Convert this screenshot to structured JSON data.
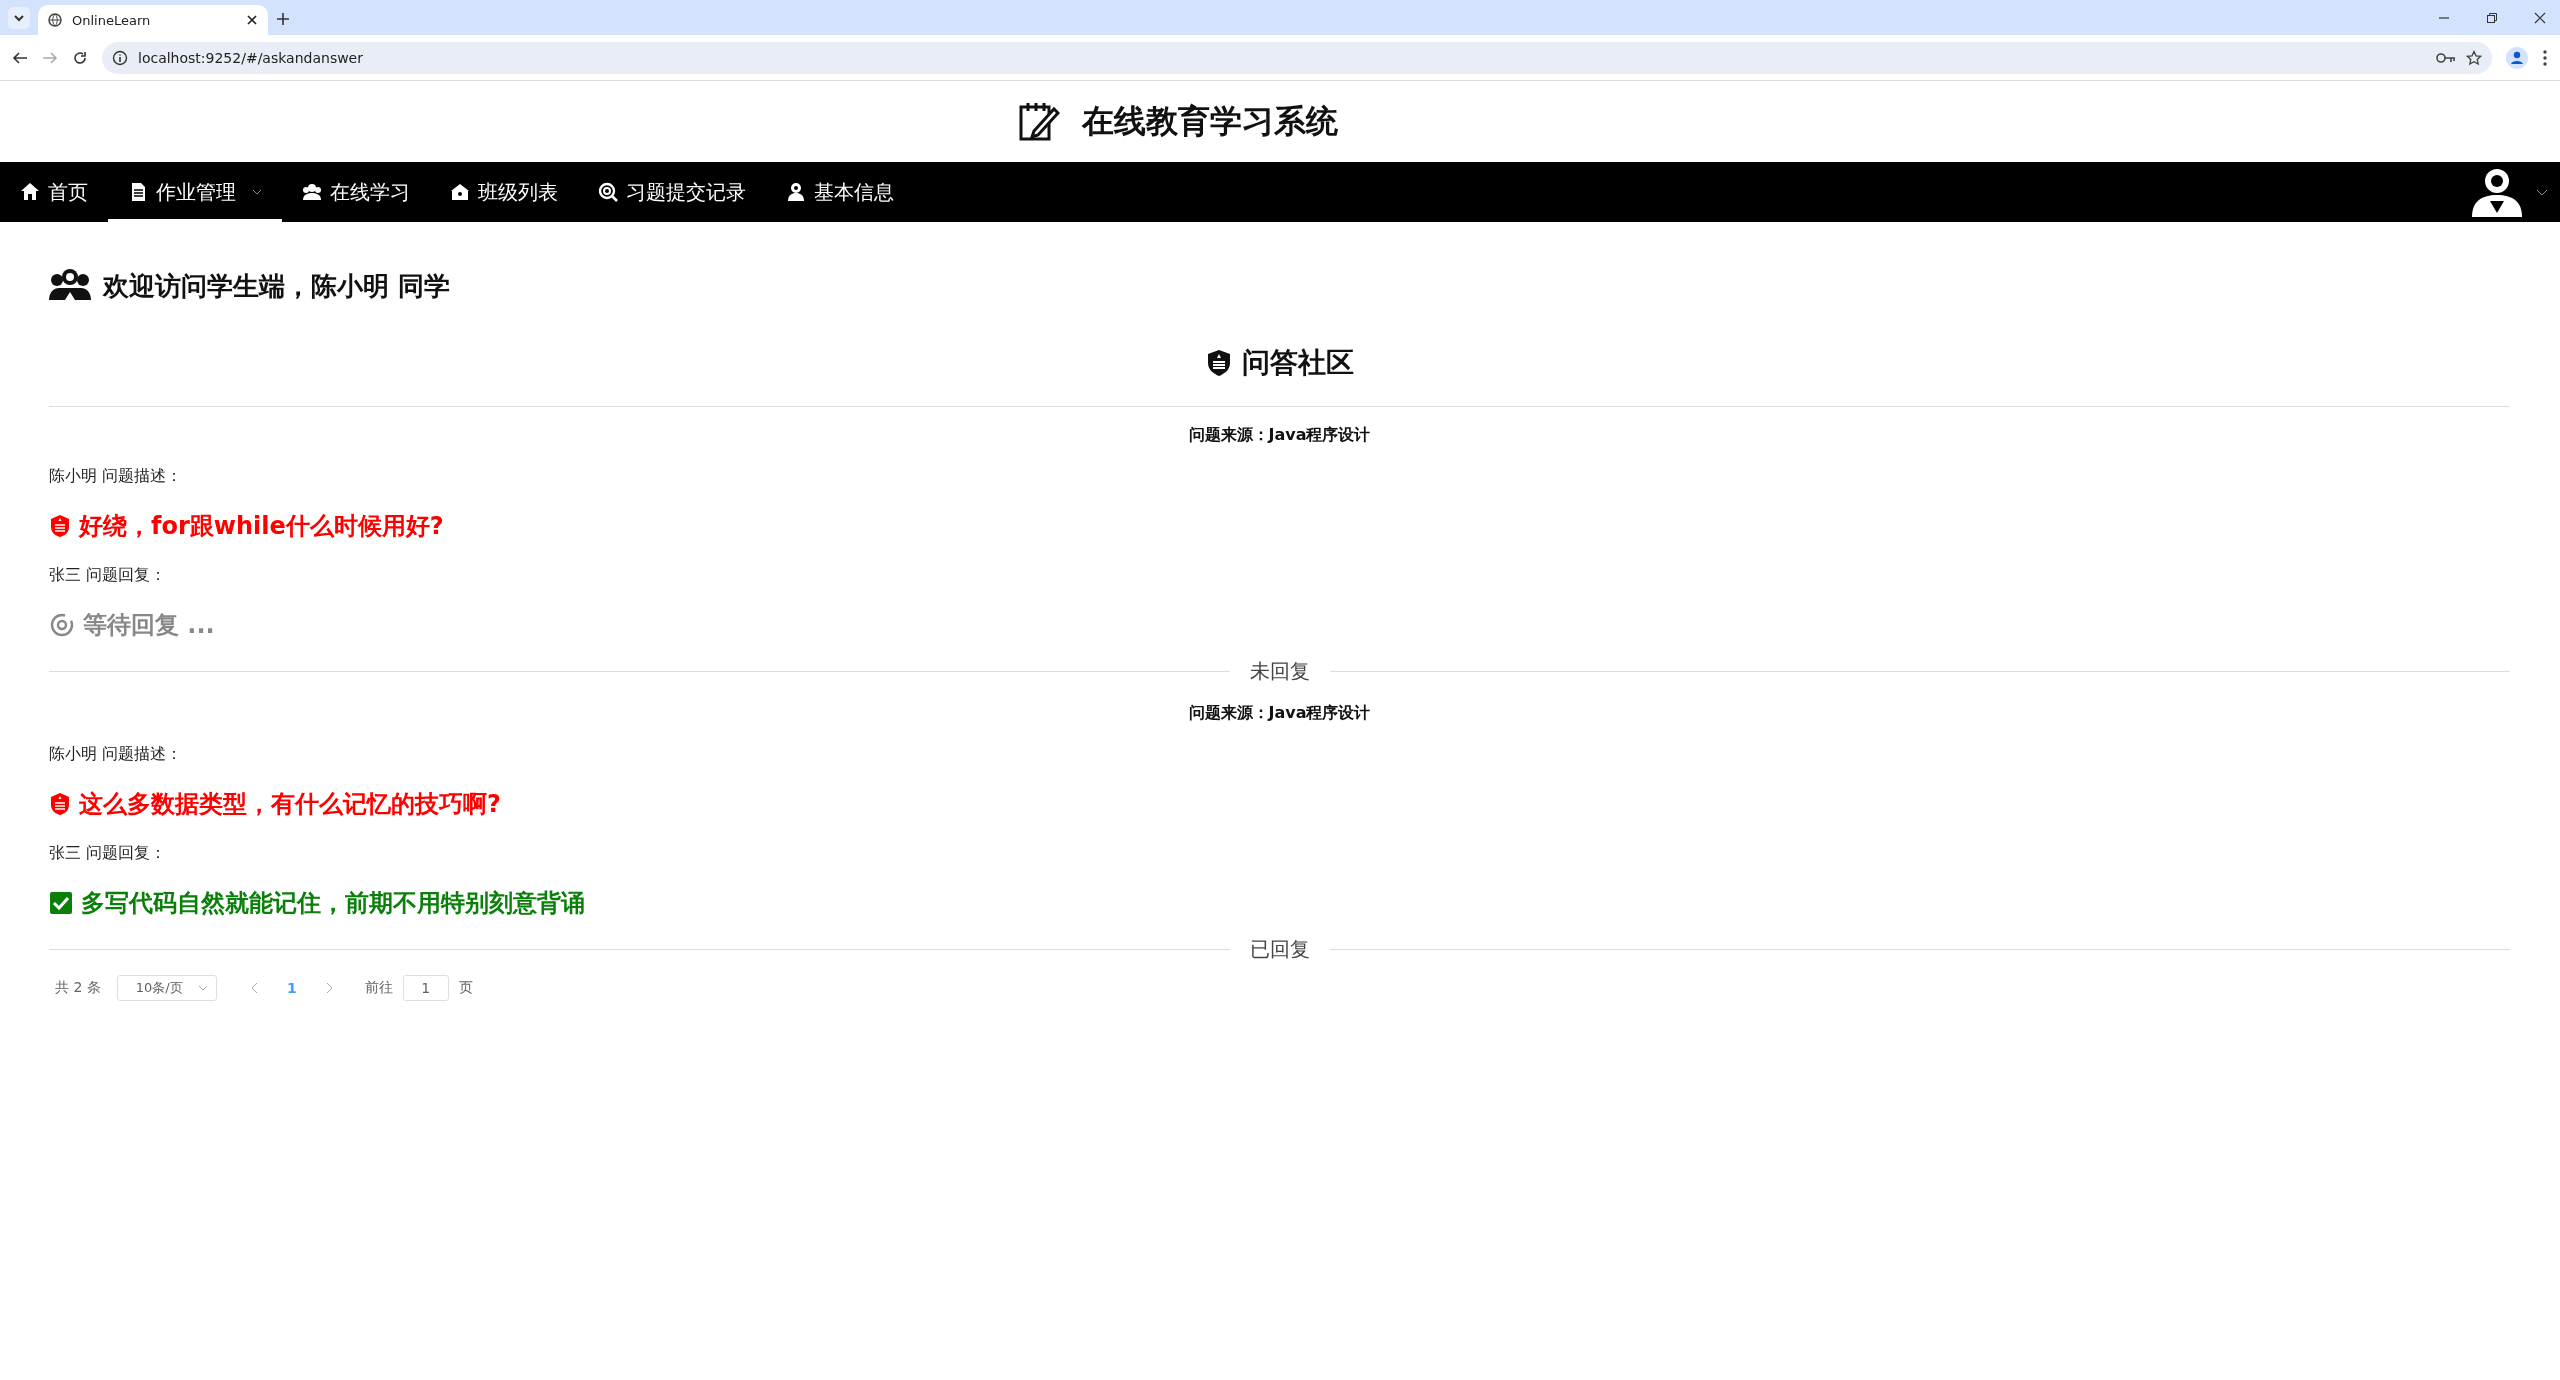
{
  "browser": {
    "tab_title": "OnlineLearn",
    "url": "localhost:9252/#/askandanswer"
  },
  "header": {
    "title": "在线教育学习系统"
  },
  "nav": {
    "items": [
      {
        "label": "首页",
        "selected": false,
        "dropdown": false
      },
      {
        "label": "作业管理",
        "selected": true,
        "dropdown": true
      },
      {
        "label": "在线学习",
        "selected": false,
        "dropdown": false
      },
      {
        "label": "班级列表",
        "selected": false,
        "dropdown": false
      },
      {
        "label": "习题提交记录",
        "selected": false,
        "dropdown": false
      },
      {
        "label": "基本信息",
        "selected": false,
        "dropdown": false
      }
    ]
  },
  "welcome": "欢迎访问学生端，陈小明 同学",
  "community": {
    "title": "问答社区"
  },
  "questions": [
    {
      "source": "问题来源：Java程序设计",
      "asker": "陈小明 问题描述：",
      "question": "好绕，for跟while什么时候用好?",
      "replier": "张三 问题回复：",
      "reply": "等待回复 ...",
      "answered": false,
      "status": "未回复"
    },
    {
      "source": "问题来源：Java程序设计",
      "asker": "陈小明 问题描述：",
      "question": "这么多数据类型，有什么记忆的技巧啊?",
      "replier": "张三 问题回复：",
      "reply": "多写代码自然就能记住，前期不用特别刻意背诵",
      "answered": true,
      "status": "已回复"
    }
  ],
  "pagination": {
    "total": "共 2 条",
    "page_size": "10条/页",
    "pages": [
      {
        "label": "1",
        "selected": true
      }
    ],
    "goto_label": "前往",
    "goto_value": "1",
    "page_suffix": "页"
  }
}
